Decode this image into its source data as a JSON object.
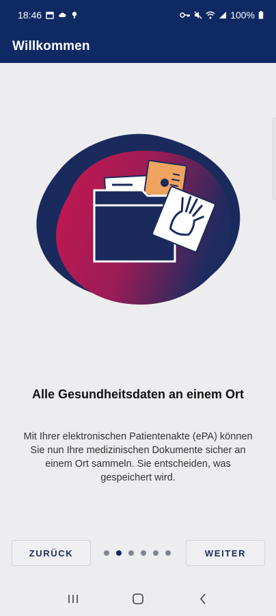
{
  "status_bar": {
    "time": "18:46",
    "battery": "100%",
    "icons_left": [
      "calendar-icon",
      "cloud-icon",
      "location-icon"
    ],
    "icons_right": [
      "key-icon",
      "mute-icon",
      "wifi-icon",
      "signal-icon",
      "battery-icon"
    ]
  },
  "app_bar": {
    "title": "Willkommen"
  },
  "onboarding": {
    "headline": "Alle Gesundheitsdaten an einem Ort",
    "body": "Mit Ihrer elektronischen Patientenakte (ePA) können Sie nun Ihre medizinischen Dokumente sicher an einem Ort sammeln. Sie entscheiden, was gespeichert wird.",
    "illustration_icon": "document-folder-xray-icon",
    "page_count": 6,
    "current_page": 2
  },
  "buttons": {
    "back": "ZURÜCK",
    "next": "WEITER"
  },
  "nav_bar": {
    "icons": [
      "recents-icon",
      "home-icon",
      "back-icon"
    ]
  },
  "colors": {
    "primary": "#0f2a63",
    "accent_pink": "#c8174f",
    "accent_orange": "#f0a35e",
    "background": "#ededf0"
  }
}
